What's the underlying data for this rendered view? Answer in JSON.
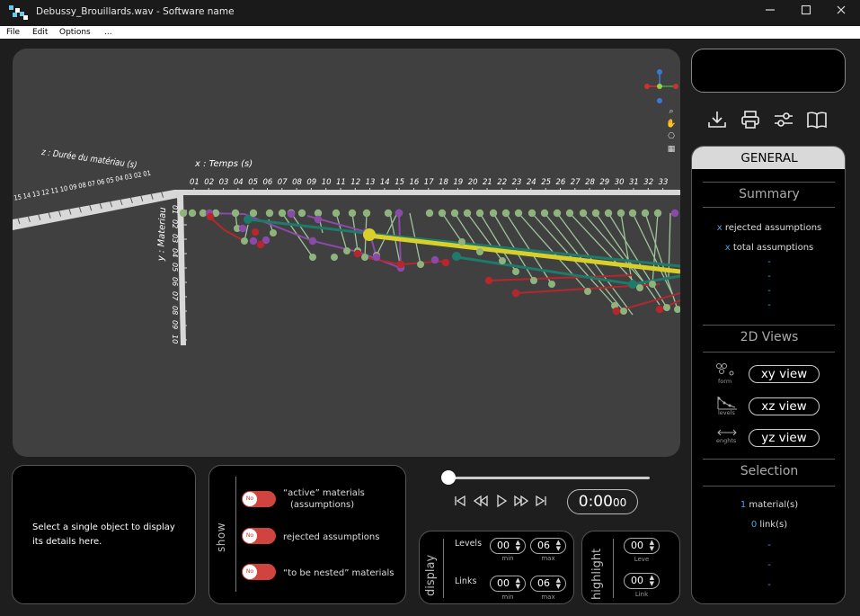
{
  "window": {
    "title": "Debussy_Brouillards.wav - Software name",
    "controls": [
      "minimize",
      "maximize",
      "close"
    ]
  },
  "menu": [
    "File",
    "Edit",
    "Options",
    "..."
  ],
  "viewport": {
    "x_axis_title": "x : Temps (s)",
    "y_axis_title": "y : Materiau",
    "z_axis_title": "z : Durée du matériau (s)",
    "x_ticks": [
      "01",
      "02",
      "03",
      "04",
      "05",
      "06",
      "07",
      "08",
      "09",
      "10",
      "11",
      "12",
      "13",
      "14",
      "15",
      "16",
      "17",
      "18",
      "19",
      "20",
      "21",
      "22",
      "23",
      "24",
      "25",
      "26",
      "27",
      "28",
      "29",
      "30",
      "31",
      "32",
      "33"
    ],
    "y_ticks": [
      "01",
      "02",
      "03",
      "04",
      "05",
      "06",
      "07",
      "08",
      "09",
      "10"
    ],
    "z_ticks": [
      "15",
      "14",
      "13",
      "12",
      "11",
      "10",
      "09",
      "08",
      "07",
      "06",
      "05",
      "04",
      "03",
      "02",
      "01"
    ],
    "colors": {
      "background": "#404040",
      "axis": "#d8d8d8",
      "node": "#8fb37d",
      "purple": "#8a4aa8",
      "red": "#b3282d",
      "teal": "#1f7a6b",
      "yellow": "#d8cf2a",
      "stem": "#9ec49a"
    }
  },
  "details": {
    "message": "Select a single object to display its details here."
  },
  "show": {
    "label": "show",
    "toggles": [
      {
        "state": "No",
        "label_line1": "“active” materials",
        "label_line2": "(assumptions)"
      },
      {
        "state": "No",
        "label_line1": "rejected assumptions",
        "label_line2": ""
      },
      {
        "state": "No",
        "label_line1": "“to be nested” materials",
        "label_line2": ""
      }
    ]
  },
  "playback": {
    "progress": 0,
    "time_main": "0:00",
    "time_small": "00"
  },
  "display": {
    "label": "display",
    "levels_label": "Levels",
    "links_label": "Links",
    "levels_min": "00",
    "levels_max": "06",
    "links_min": "00",
    "links_max": "06",
    "min_label": "min",
    "max_label": "max"
  },
  "highlight": {
    "label": "highlight",
    "level_value": "00",
    "link_value": "00",
    "level_label": "Leve",
    "link_label": "Link"
  },
  "general": {
    "header": "GENERAL",
    "summary_title": "Summary",
    "rejected_prefix": "x",
    "rejected_text": " rejected assumptions",
    "total_prefix": "x",
    "total_text": " total assumptions",
    "summary_dashes": [
      "-",
      "-",
      "-",
      "-"
    ],
    "views_title": "2D Views",
    "views": [
      {
        "icon_label": "form",
        "button": "xy view"
      },
      {
        "icon_label": "levels",
        "button": "xz view"
      },
      {
        "icon_label": "enghts",
        "button": "yz view"
      }
    ],
    "selection_title": "Selection",
    "materials_count": "1",
    "materials_text": " material(s)",
    "links_count": "0",
    "links_text": " link(s)",
    "selection_dashes": [
      "-",
      "-",
      "-"
    ]
  }
}
